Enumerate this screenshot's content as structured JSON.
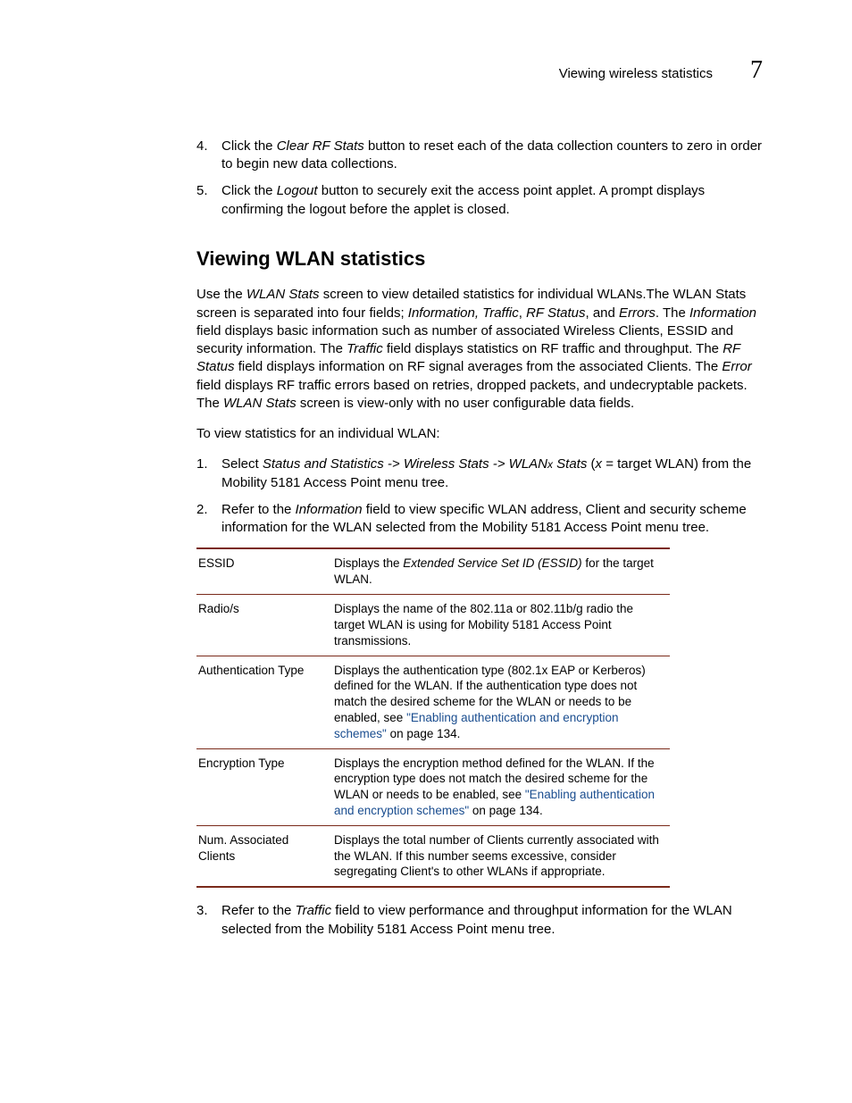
{
  "header": {
    "running_title": "Viewing wireless statistics",
    "chapter_number": "7"
  },
  "steps_a": [
    {
      "num": "4.",
      "pre": "Click the ",
      "em": "Clear RF Stats",
      "post": " button to reset each of the data collection counters to zero in order to begin new data collections."
    },
    {
      "num": "5.",
      "pre": "Click the ",
      "em": "Logout",
      "post": " button to securely exit the access point applet. A prompt displays confirming the logout before the applet is closed."
    }
  ],
  "section_title": "Viewing WLAN statistics",
  "intro": {
    "p1_a": "Use the ",
    "p1_em1": "WLAN Stats",
    "p1_b": " screen to view detailed statistics for individual WLANs.The WLAN Stats screen is separated into four fields; ",
    "p1_em2": "Information, Traffic",
    "p1_c": ", ",
    "p1_em3": "RF Status",
    "p1_d": ", and ",
    "p1_em4": "Errors",
    "p1_e": ". The ",
    "p1_em5": "Information",
    "p1_f": " field displays basic information such as number of associated Wireless Clients, ESSID and security information. The ",
    "p1_em6": "Traffic",
    "p1_g": " field displays statistics on RF traffic and throughput. The ",
    "p1_em7": "RF Status",
    "p1_h": " field displays information on RF signal averages from the associated Clients. The ",
    "p1_em8": "Error",
    "p1_i": " field displays RF traffic errors based on retries, dropped packets, and undecryptable packets. The ",
    "p1_em9": "WLAN Stats",
    "p1_j": " screen is view-only with no user configurable data fields."
  },
  "lead_in": "To view statistics for an individual WLAN:",
  "steps_b": [
    {
      "num": "1.",
      "pre": "Select ",
      "em": "Status and Statistics -> Wireless Stats -> WLAN",
      "mid_em": "x",
      "mid_em2": " Stats",
      "paren_open": " (",
      "paren_em": "x",
      "post": " = target WLAN) from the Mobility 5181 Access Point menu tree."
    },
    {
      "num": "2.",
      "pre": "Refer to the ",
      "em": "Information",
      "post": " field to view specific WLAN address, Client and security scheme information for the WLAN selected from the Mobility 5181 Access Point menu tree."
    }
  ],
  "table": [
    {
      "term": "ESSID",
      "desc_pre": "Displays the ",
      "desc_em": "Extended Service Set ID (ESSID)",
      "desc_post": " for the target WLAN."
    },
    {
      "term": "Radio/s",
      "desc": "Displays the name of the 802.11a or 802.11b/g radio the target WLAN is using for Mobility 5181 Access Point transmissions."
    },
    {
      "term": "Authentication Type",
      "desc_pre": "Displays the authentication type (802.1x EAP or Kerberos) defined for the WLAN. If the authentication type does not match the desired scheme for the WLAN or needs to be enabled, see ",
      "link": "\"Enabling authentication and encryption schemes\"",
      "desc_post": " on page 134."
    },
    {
      "term": "Encryption Type",
      "desc_pre": "Displays the encryption method defined for the WLAN. If the encryption type does not match the desired scheme for the WLAN or needs to be enabled, see ",
      "link": "\"Enabling authentication and encryption schemes\"",
      "desc_post": " on page 134."
    },
    {
      "term": "Num. Associated Clients",
      "desc": "Displays the total number of Clients currently associated with the WLAN. If this number seems excessive, consider segregating Client's to other WLANs if appropriate."
    }
  ],
  "steps_c": [
    {
      "num": "3.",
      "pre": "Refer to the ",
      "em": "Traffic",
      "post": " field to view performance and throughput information for the WLAN selected from the Mobility 5181 Access Point menu tree."
    }
  ]
}
